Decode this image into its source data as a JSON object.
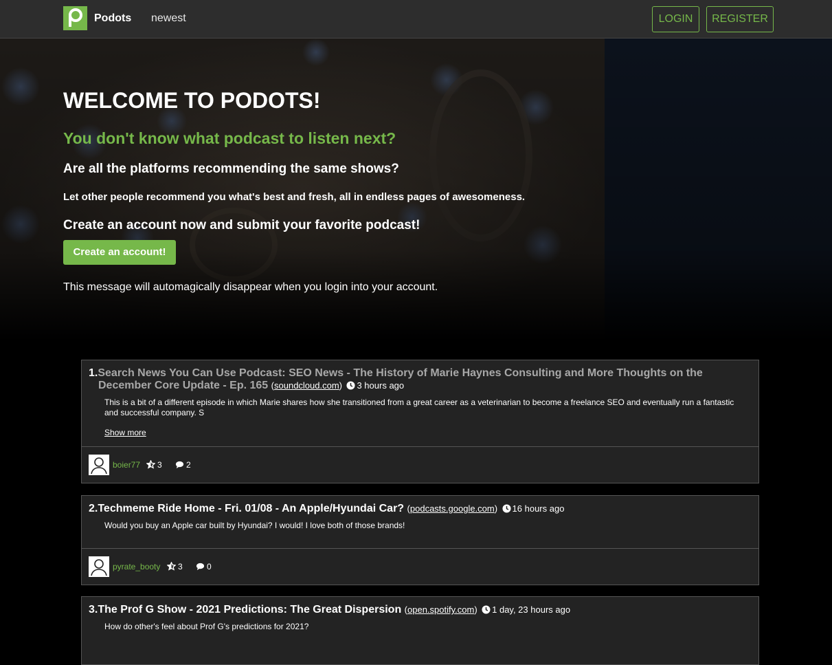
{
  "navbar": {
    "brand": "Podots",
    "nav_link": "newest",
    "login": "LOGIN",
    "register": "REGISTER"
  },
  "hero": {
    "title": "WELCOME TO PODOTS!",
    "subtitle": "You don't know what podcast to listen next?",
    "question": "Are all the platforms recommending the same shows?",
    "pitch": "Let other people recommend you what's best and fresh, all in endless pages of awesomeness.",
    "cta_text": "Create an account now and submit your favorite podcast!",
    "cta_button": "Create an account!",
    "note": "This message will automagically disappear when you login into your account."
  },
  "posts": [
    {
      "number": "1.",
      "title": "Search News You Can Use Podcast: SEO News - The History of Marie Haynes Consulting and More Thoughts on the December Core Update - Ep. 165",
      "source": "soundcloud.com",
      "time": "3 hours ago",
      "description": "This is a bit of a different episode in which Marie shares how she transitioned from a great career as a veterinarian to become a freelance SEO and eventually run a fantastic and successful company. S",
      "show_more": "Show more",
      "user": "boier77",
      "stars": "3",
      "comments": "2"
    },
    {
      "number": "2.",
      "title": "Techmeme Ride Home - Fri. 01/08 - An Apple/Hyundai Car?",
      "source": "podcasts.google.com",
      "time": "16 hours ago",
      "description": "Would you buy an Apple car built by Hyundai? I would! I love both of those brands!",
      "user": "pyrate_booty",
      "stars": "3",
      "comments": "0"
    },
    {
      "number": "3.",
      "title": "The Prof G Show - 2021 Predictions: The Great Dispersion",
      "source": "open.spotify.com",
      "time": "1 day, 23 hours ago",
      "description": "How do other's feel about Prof G's predictions for 2021?"
    }
  ],
  "colors": {
    "accent": "#76b84a",
    "navbar": "#2d2d2d",
    "card": "#232323"
  }
}
